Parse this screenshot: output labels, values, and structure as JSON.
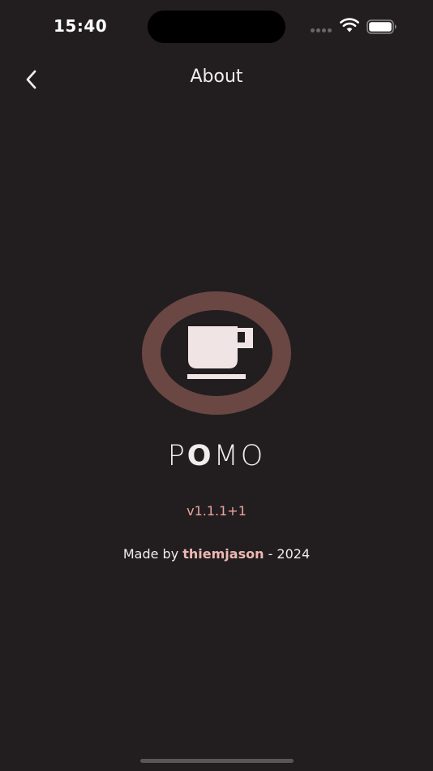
{
  "status_bar": {
    "time": "15:40",
    "signal_icon": "cellular-signal-icon",
    "wifi_icon": "wifi-icon",
    "battery_icon": "battery-icon"
  },
  "nav": {
    "title": "About",
    "back_icon": "chevron-left-icon"
  },
  "logo": {
    "icon": "coffee-cup-icon",
    "ring_color": "#6b4743",
    "cup_color": "#f1e4e4"
  },
  "app_name": {
    "part1": "P",
    "part2": "O",
    "part3": "MO"
  },
  "version": "v1.1.1+1",
  "credits": {
    "prefix": "Made by ",
    "author": "thiemjason",
    "suffix": " - 2024"
  },
  "colors": {
    "background": "#221e1f",
    "text": "#f2ecec",
    "accent": "#e9a4a0"
  }
}
